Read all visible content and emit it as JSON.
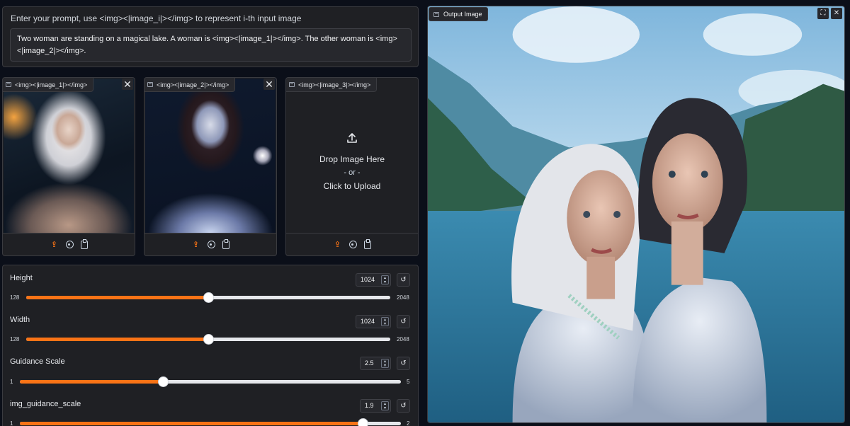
{
  "prompt": {
    "label": "Enter your prompt, use <img><|image_i|></img> to represent i-th input image",
    "value": "Two woman are standing on a magical lake. A woman is <img><|image_1|></img>. The other woman is <img><|image_2|></img>."
  },
  "images": [
    {
      "tag": "<img><|image_1|></img>",
      "has_image": true,
      "close": "✕"
    },
    {
      "tag": "<img><|image_2|></img>",
      "has_image": true,
      "close": "✕"
    },
    {
      "tag": "<img><|image_3|></img>",
      "has_image": false,
      "drop_text": "Drop Image Here",
      "or_text": "- or -",
      "click_text": "Click to Upload"
    }
  ],
  "sliders": [
    {
      "label": "Height",
      "value": "1024",
      "min": "128",
      "max": "2048",
      "fraction": 0.5
    },
    {
      "label": "Width",
      "value": "1024",
      "min": "128",
      "max": "2048",
      "fraction": 0.5
    },
    {
      "label": "Guidance Scale",
      "value": "2.5",
      "min": "1",
      "max": "5",
      "fraction": 0.375
    },
    {
      "label": "img_guidance_scale",
      "value": "1.9",
      "min": "1",
      "max": "2",
      "fraction": 0.9
    }
  ],
  "output": {
    "label": "Output Image"
  },
  "icons": {
    "image_tag": "image-icon",
    "upload": "upload-icon",
    "webcam": "webcam-icon",
    "clipboard": "clipboard-icon",
    "reset": "reset-icon",
    "fullscreen": "fullscreen-icon",
    "close": "close-icon"
  },
  "colors": {
    "accent": "#f97316",
    "panel": "#1f2024",
    "background": "#0b0f19"
  }
}
